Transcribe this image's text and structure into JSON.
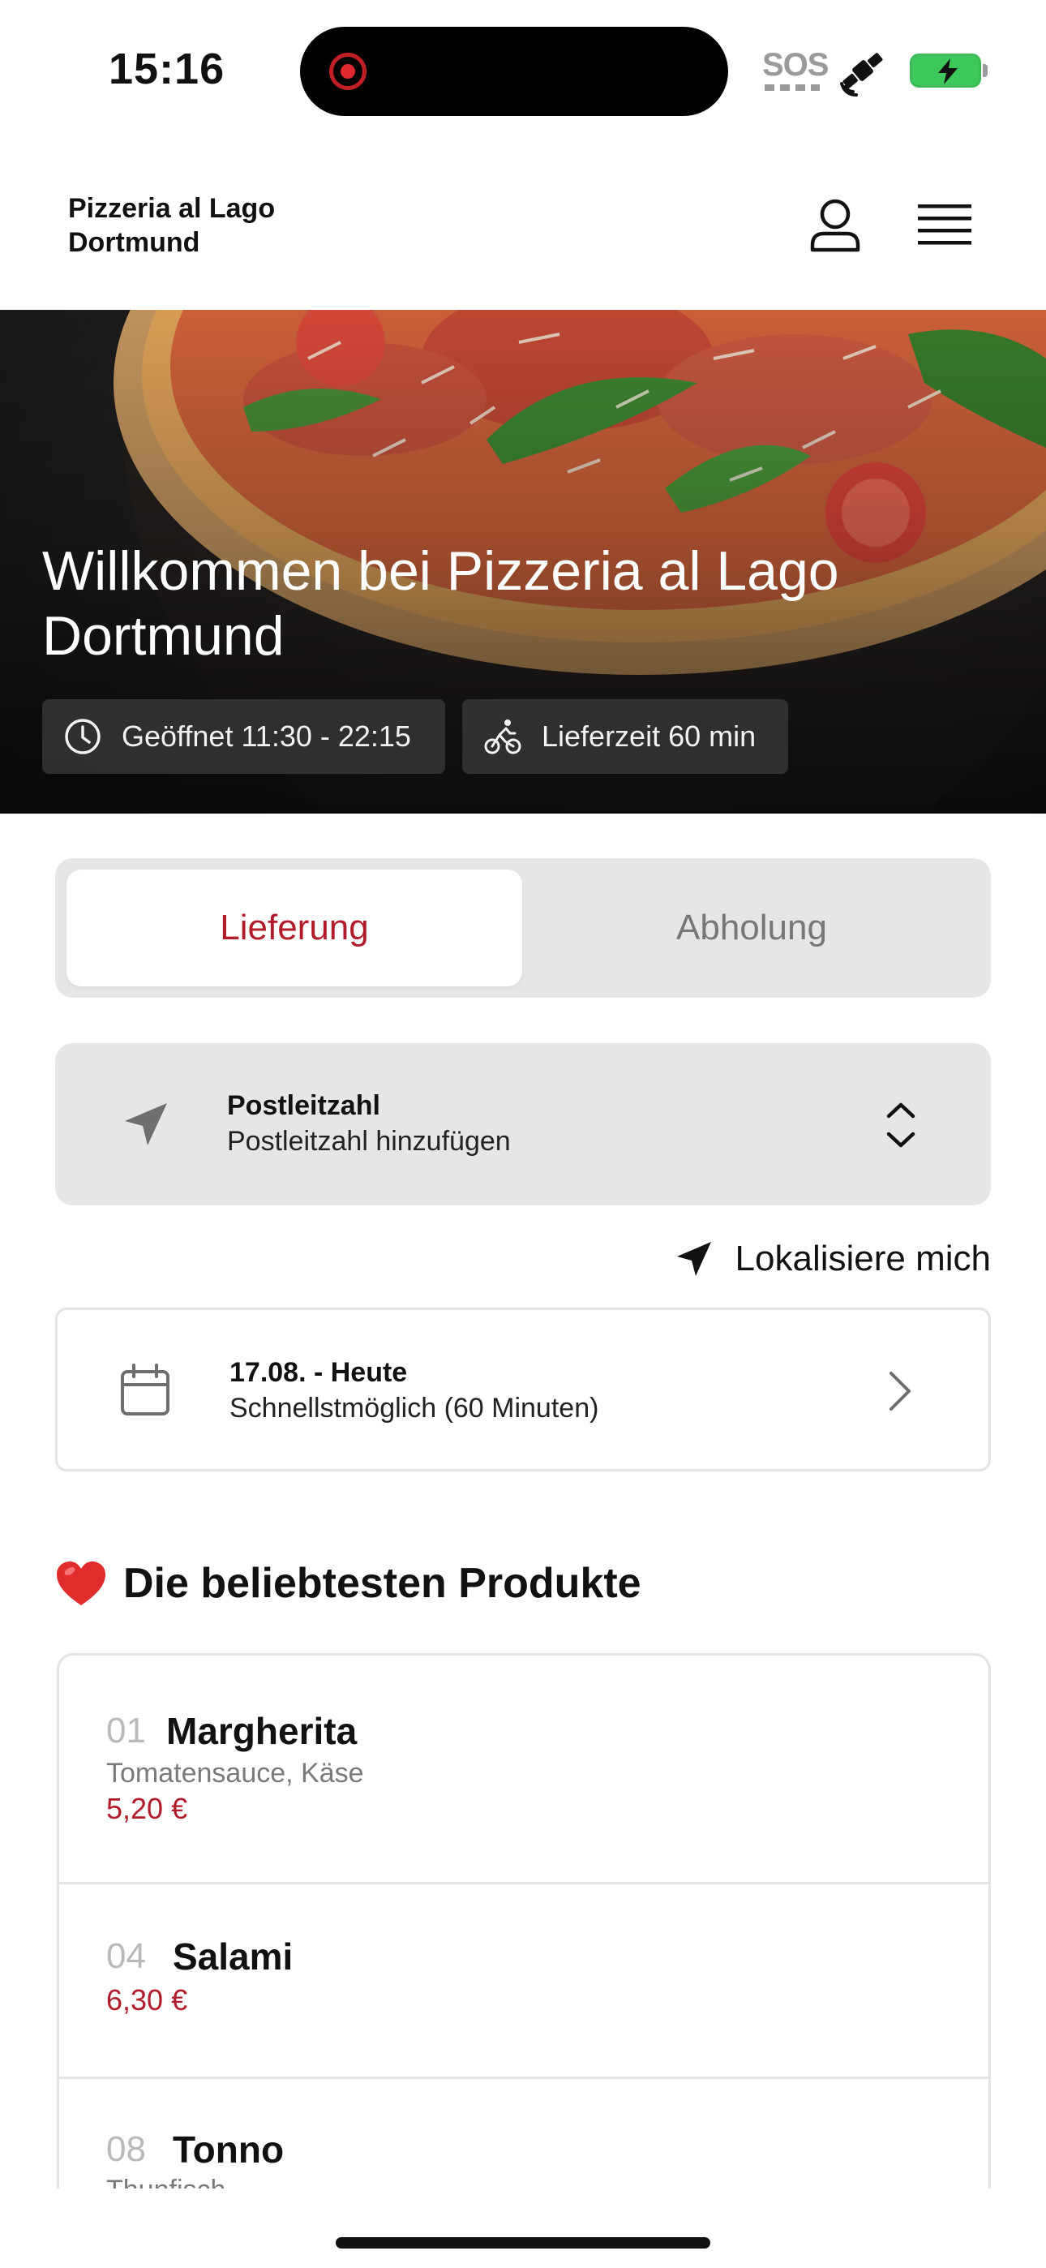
{
  "status_bar": {
    "time": "15:16",
    "sos": "SOS",
    "icons": [
      "recording-dot-icon",
      "satellite-icon",
      "battery-charging-icon"
    ]
  },
  "header": {
    "brand": "Pizzeria al Lago Dortmund",
    "icons": [
      "user-icon",
      "menu-icon"
    ]
  },
  "hero": {
    "title": "Willkommen bei Pizzeria al Lago Dortmund",
    "hours": "Geöffnet 11:30 - 22:15",
    "delivery_time": "Lieferzeit 60 min"
  },
  "order_mode": {
    "delivery": "Lieferung",
    "pickup": "Abholung",
    "selected": "delivery"
  },
  "postal": {
    "title": "Postleitzahl",
    "placeholder": "Postleitzahl hinzufügen"
  },
  "locate": {
    "label": "Lokalisiere mich"
  },
  "schedule": {
    "date": "17.08. - Heute",
    "time": "Schnellstmöglich (60 Minuten)"
  },
  "popular": {
    "title": "Die beliebtesten Produkte",
    "products": [
      {
        "number": "01",
        "name": "Margherita",
        "description": "Tomatensauce, Käse",
        "price": "5,20 €"
      },
      {
        "number": "04",
        "name": "Salami",
        "description": "",
        "price": "6,30 €"
      },
      {
        "number": "08",
        "name": "Tonno",
        "description": "Thunfisch",
        "price": ""
      }
    ]
  },
  "colors": {
    "accent": "#b11c2a",
    "segment_bg": "#e6e6e6",
    "battery": "#3cc85a"
  }
}
